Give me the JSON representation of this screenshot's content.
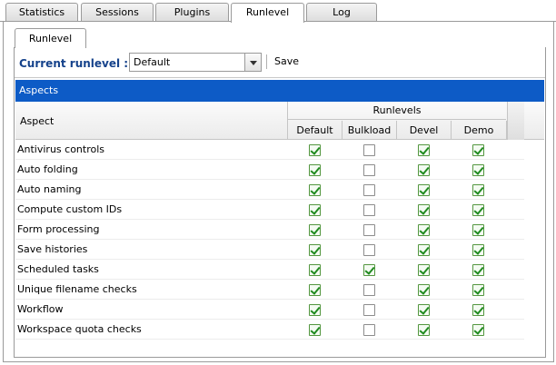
{
  "top_tabs": [
    {
      "label": "Statistics",
      "active": false
    },
    {
      "label": "Sessions",
      "active": false
    },
    {
      "label": "Plugins",
      "active": false
    },
    {
      "label": "Runlevel",
      "active": true
    },
    {
      "label": "Log",
      "active": false
    }
  ],
  "sub_tab": {
    "label": "Runlevel"
  },
  "toolbar": {
    "current_runlevel_label": "Current runlevel :",
    "runlevel_value": "Default",
    "save_label": "Save"
  },
  "aspects_title": "Aspects",
  "grid": {
    "aspect_header": "Aspect",
    "runlevels_header": "Runlevels",
    "columns": [
      "Default",
      "Bulkload",
      "Devel",
      "Demo"
    ],
    "rows": [
      {
        "aspect": "Antivirus controls",
        "values": [
          true,
          false,
          true,
          true
        ]
      },
      {
        "aspect": "Auto folding",
        "values": [
          true,
          false,
          true,
          true
        ]
      },
      {
        "aspect": "Auto naming",
        "values": [
          true,
          false,
          true,
          true
        ]
      },
      {
        "aspect": "Compute custom IDs",
        "values": [
          true,
          false,
          true,
          true
        ]
      },
      {
        "aspect": "Form processing",
        "values": [
          true,
          false,
          true,
          true
        ]
      },
      {
        "aspect": "Save histories",
        "values": [
          true,
          false,
          true,
          true
        ]
      },
      {
        "aspect": "Scheduled tasks",
        "values": [
          true,
          true,
          true,
          true
        ]
      },
      {
        "aspect": "Unique filename checks",
        "values": [
          true,
          false,
          true,
          true
        ]
      },
      {
        "aspect": "Workflow",
        "values": [
          true,
          false,
          true,
          true
        ]
      },
      {
        "aspect": "Workspace quota checks",
        "values": [
          true,
          false,
          true,
          true
        ]
      }
    ]
  },
  "colors": {
    "accent_bar": "#0d5bc6",
    "label_blue": "#15428b",
    "check_green": "#1f8a1f"
  }
}
